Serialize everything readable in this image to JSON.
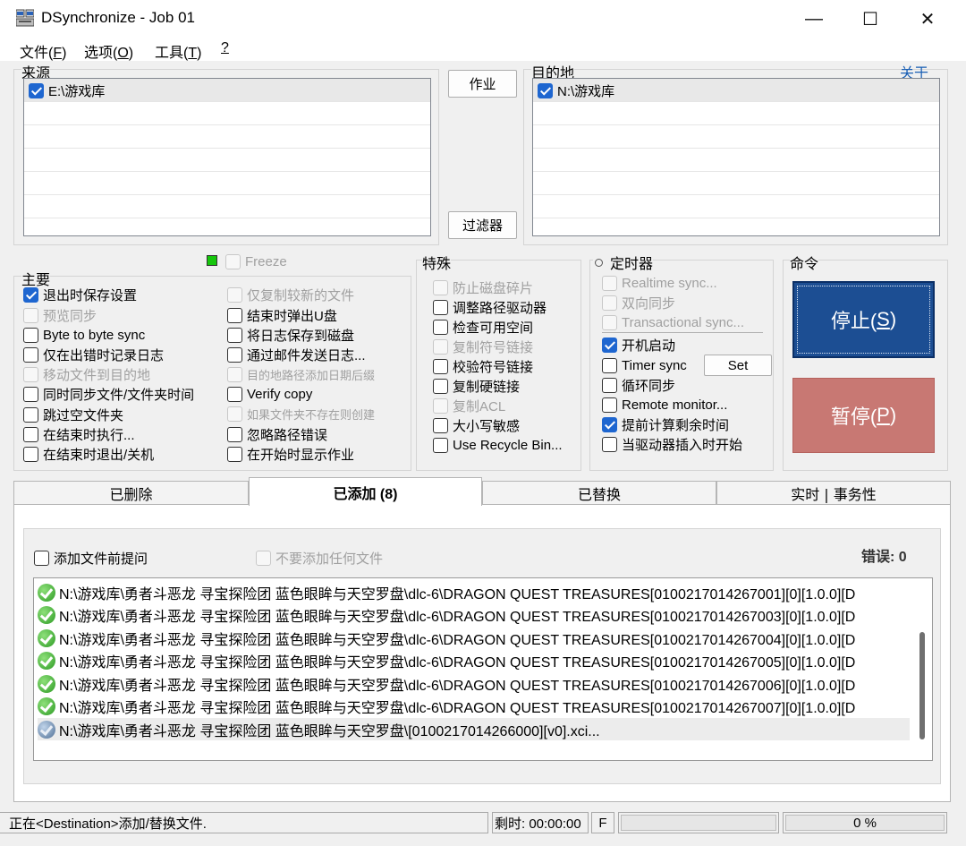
{
  "window": {
    "title": "DSynchronize - Job 01",
    "minimize_glyph": "—",
    "maximize_glyph": "☐",
    "close_glyph": "✕"
  },
  "menu": [
    {
      "label": "文件(",
      "key": "F",
      "tail": ")"
    },
    {
      "label": "选项(",
      "key": "O",
      "tail": ")"
    },
    {
      "label": "工具(",
      "key": "T",
      "tail": ")"
    },
    {
      "label": "",
      "key": "?",
      "tail": ""
    }
  ],
  "source": {
    "title": "来源",
    "items": [
      {
        "path": "E:\\游戏库",
        "checked": true
      }
    ]
  },
  "middle_buttons": {
    "job": "作业",
    "filter": "过滤器"
  },
  "destination": {
    "title": "目的地",
    "about_link": "关于",
    "items": [
      {
        "path": "N:\\游戏库",
        "checked": true
      }
    ]
  },
  "freeze": {
    "label": "Freeze",
    "indicator_color": "#16c60c"
  },
  "main_options": {
    "title": "主要",
    "col1": [
      {
        "label": "退出时保存设置",
        "checked": true,
        "disabled": false
      },
      {
        "label": "预览同步",
        "checked": false,
        "disabled": true
      },
      {
        "label": "Byte to byte sync",
        "checked": false,
        "disabled": false
      },
      {
        "label": "仅在出错时记录日志",
        "checked": false,
        "disabled": false
      },
      {
        "label": "移动文件到目的地",
        "checked": false,
        "disabled": true
      },
      {
        "label": "同时同步文件/文件夹时间",
        "checked": false,
        "disabled": false
      },
      {
        "label": "跳过空文件夹",
        "checked": false,
        "disabled": false
      },
      {
        "label": "在结束时执行...",
        "checked": false,
        "disabled": false
      },
      {
        "label": "在结束时退出/关机",
        "checked": false,
        "disabled": false
      }
    ],
    "col2": [
      {
        "label": "仅复制较新的文件",
        "checked": false,
        "disabled": true
      },
      {
        "label": "结束时弹出U盘",
        "checked": false,
        "disabled": false
      },
      {
        "label": "将日志保存到磁盘",
        "checked": false,
        "disabled": false
      },
      {
        "label": "通过邮件发送日志...",
        "checked": false,
        "disabled": false
      },
      {
        "label": "目的地路径添加日期后缀",
        "checked": false,
        "disabled": true,
        "small": true
      },
      {
        "label": "Verify copy",
        "checked": false,
        "disabled": false
      },
      {
        "label": "如果文件夹不存在则创建",
        "checked": false,
        "disabled": true,
        "small": true
      },
      {
        "label": "忽略路径错误",
        "checked": false,
        "disabled": false
      },
      {
        "label": "在开始时显示作业",
        "checked": false,
        "disabled": false
      }
    ]
  },
  "special": {
    "title": "特殊",
    "items": [
      {
        "label": "防止磁盘碎片",
        "checked": false,
        "disabled": true
      },
      {
        "label": "调整路径驱动器",
        "checked": false,
        "disabled": false
      },
      {
        "label": "检查可用空间",
        "checked": false,
        "disabled": false
      },
      {
        "label": "复制符号链接",
        "checked": false,
        "disabled": true
      },
      {
        "label": "校验符号链接",
        "checked": false,
        "disabled": false
      },
      {
        "label": "复制硬链接",
        "checked": false,
        "disabled": false
      },
      {
        "label": "复制ACL",
        "checked": false,
        "disabled": true
      },
      {
        "label": "大小写敏感",
        "checked": false,
        "disabled": false
      },
      {
        "label": "Use Recycle Bin...",
        "checked": false,
        "disabled": false
      }
    ]
  },
  "timer": {
    "title": "定时器",
    "set_button": "Set",
    "items": [
      {
        "label": "Realtime sync...",
        "checked": false,
        "disabled": true
      },
      {
        "label": "双向同步",
        "checked": false,
        "disabled": true
      },
      {
        "label": "Transactional sync...",
        "checked": false,
        "disabled": true
      },
      {
        "label": "开机启动",
        "checked": true,
        "disabled": false
      },
      {
        "label": "Timer sync",
        "checked": false,
        "disabled": false
      },
      {
        "label": "循环同步",
        "checked": false,
        "disabled": false
      },
      {
        "label": "Remote monitor...",
        "checked": false,
        "disabled": false
      },
      {
        "label": "提前计算剩余时间",
        "checked": true,
        "disabled": false
      },
      {
        "label": "当驱动器插入时开始",
        "checked": false,
        "disabled": false
      }
    ]
  },
  "commands": {
    "title": "命令",
    "stop_label": "停止(",
    "stop_key": "S",
    "pause_label": "暂停(",
    "pause_key": "P",
    "close_paren": ")",
    "stop_color": "#1c4e93",
    "pause_color": "#c87873"
  },
  "tabs": [
    {
      "label": "已删除",
      "active": false
    },
    {
      "label": "已添加 (8)",
      "active": true
    },
    {
      "label": "已替换",
      "active": false
    },
    {
      "label": "实时 | 事务性",
      "active": false
    }
  ],
  "added_panel": {
    "ask_before_add": "添加文件前提问",
    "dont_add_any": "不要添加任何文件",
    "errors": "错误: 0",
    "files": [
      {
        "path": "N:\\游戏库\\勇者斗恶龙 寻宝探险团 蓝色眼眸与天空罗盘\\dlc-6\\DRAGON QUEST TREASURES[010021701426700​1][0][1.0.0][D",
        "status": "done"
      },
      {
        "path": "N:\\游戏库\\勇者斗恶龙 寻宝探险团 蓝色眼眸与天空罗盘\\dlc-6\\DRAGON QUEST TREASURES[0100217014267003][0][1.0.0][D",
        "status": "done"
      },
      {
        "path": "N:\\游戏库\\勇者斗恶龙 寻宝探险团 蓝色眼眸与天空罗盘\\dlc-6\\DRAGON QUEST TREASURES[0100217014267004][0][1.0.0][D",
        "status": "done"
      },
      {
        "path": "N:\\游戏库\\勇者斗恶龙 寻宝探险团 蓝色眼眸与天空罗盘\\dlc-6\\DRAGON QUEST TREASURES[0100217014267005][0][1.0.0][D",
        "status": "done"
      },
      {
        "path": "N:\\游戏库\\勇者斗恶龙 寻宝探险团 蓝色眼眸与天空罗盘\\dlc-6\\DRAGON QUEST TREASURES[0100217014267006][0][1.0.0][D",
        "status": "done"
      },
      {
        "path": "N:\\游戏库\\勇者斗恶龙 寻宝探险团 蓝色眼眸与天空罗盘\\dlc-6\\DRAGON QUEST TREASURES[0100217014267007][0][1.0.0][D",
        "status": "done"
      },
      {
        "path": "N:\\游戏库\\勇者斗恶龙 寻宝探险团 蓝色眼眸与天空罗盘\\[0100217014266000][v0].xci...",
        "status": "in-progress"
      }
    ]
  },
  "statusbar": {
    "message": "正在<Destination>添加/替换文件.",
    "time_label": "剩时: 00:00:00",
    "drive": "F",
    "progress_total": "0 %",
    "progress_fraction": 0.0
  }
}
